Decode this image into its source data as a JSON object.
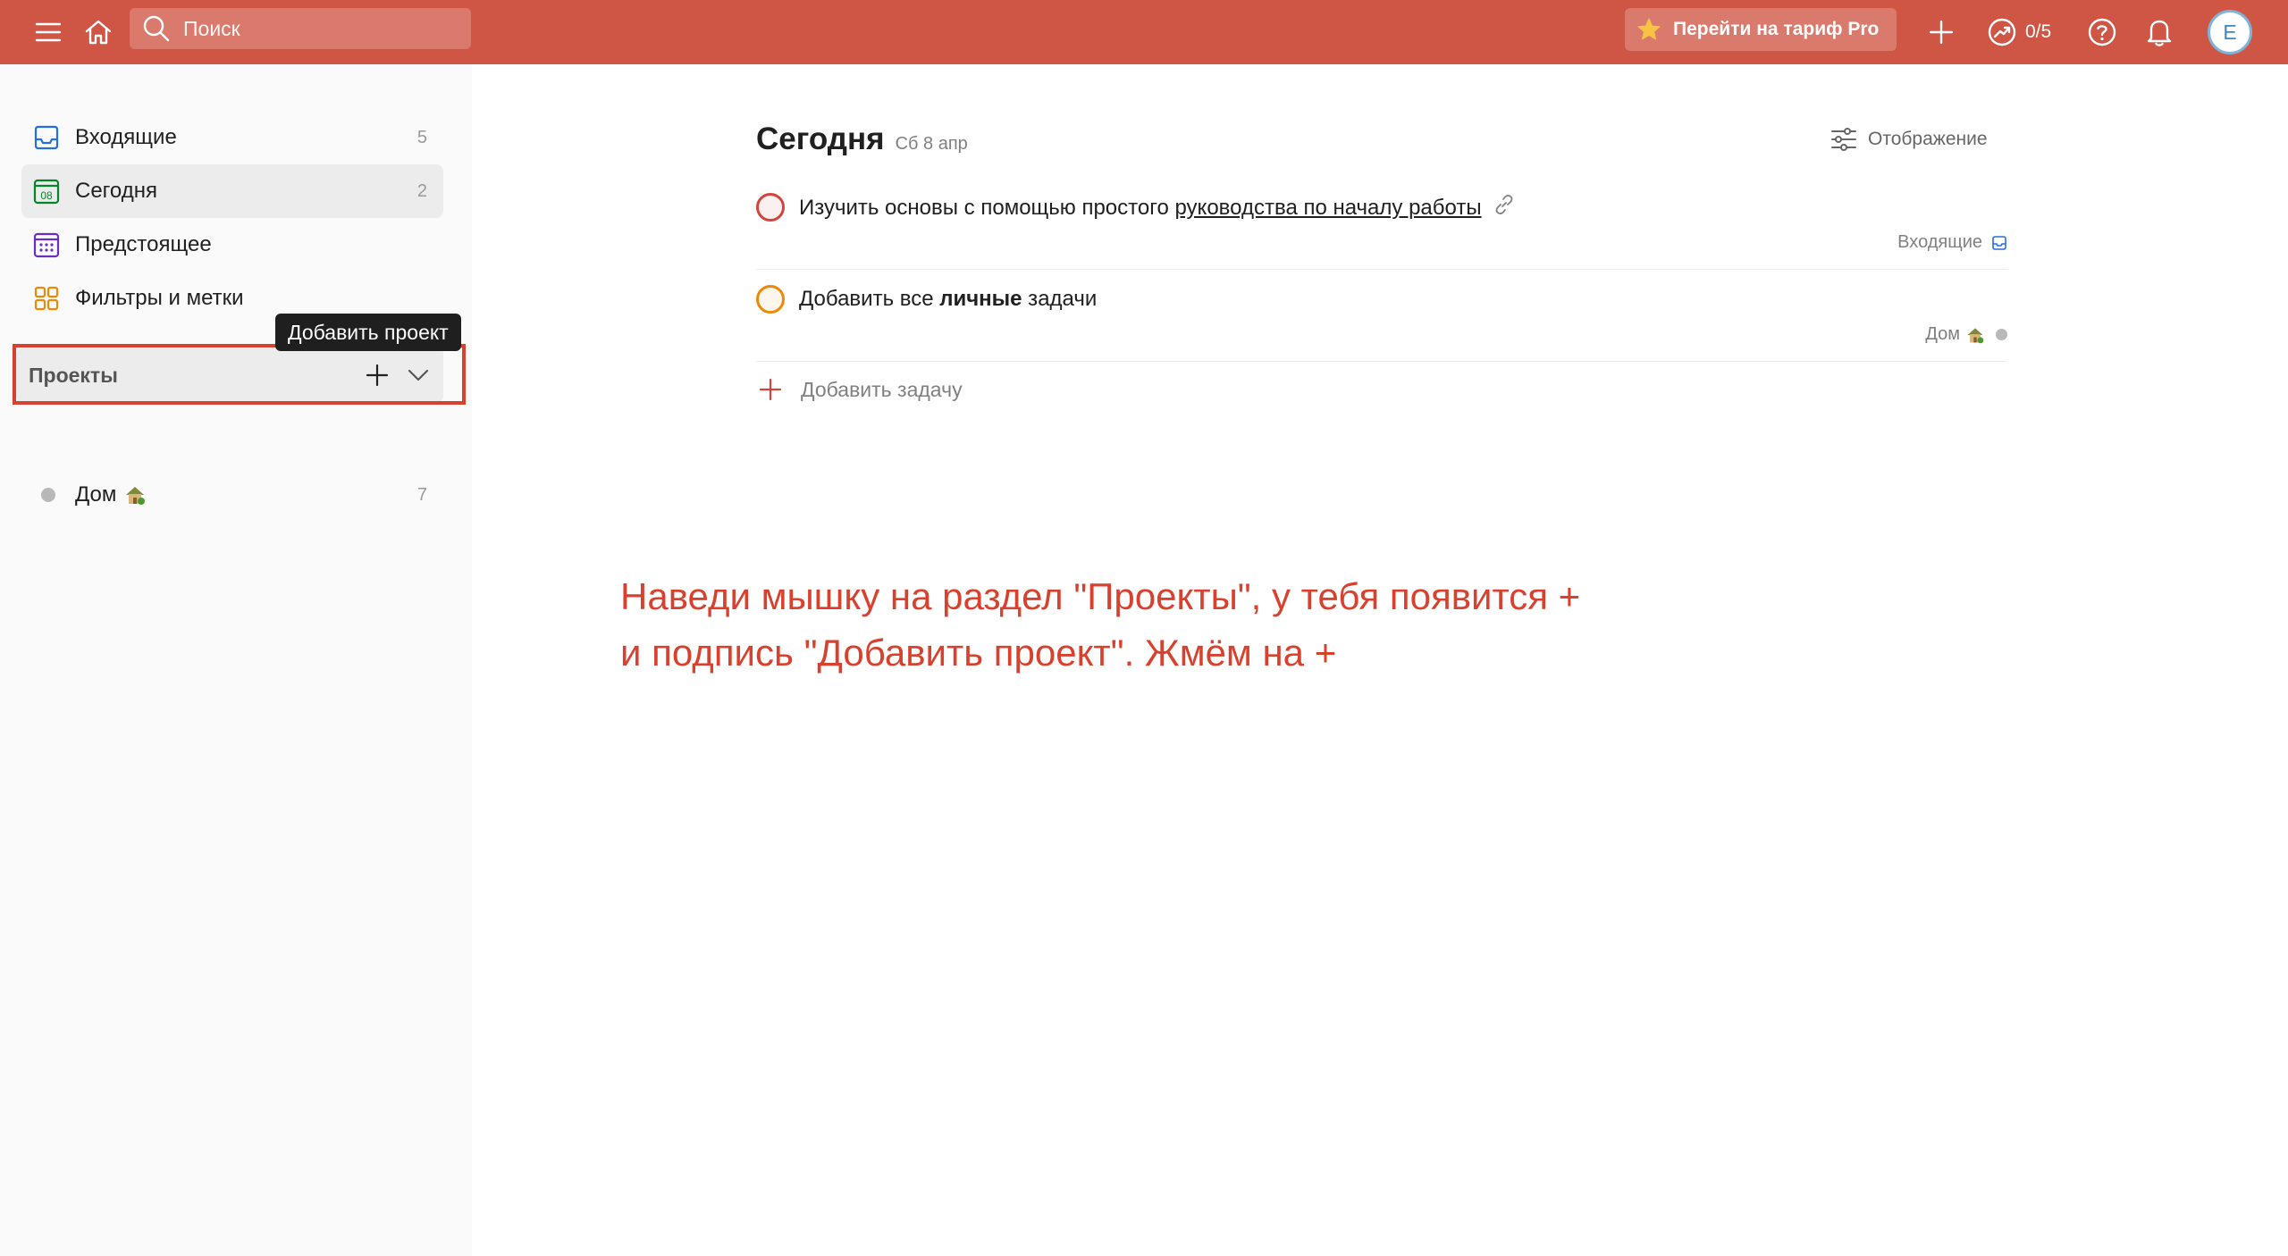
{
  "topbar": {
    "search_placeholder": "Поиск",
    "pro_button_label": "Перейти на тариф Pro",
    "karma_value": "0/5",
    "avatar_letter": "E",
    "brand_color": "#cf5545"
  },
  "sidebar": {
    "items": [
      {
        "label": "Входящие",
        "count": "5",
        "icon": "inbox-icon"
      },
      {
        "label": "Сегодня",
        "count": "2",
        "icon": "calendar-today-icon"
      },
      {
        "label": "Предстоящее",
        "count": "",
        "icon": "calendar-upcoming-icon"
      },
      {
        "label": "Фильтры и метки",
        "count": "",
        "icon": "filters-grid-icon"
      }
    ],
    "projects_label": "Проекты",
    "tooltip": "Добавить проект",
    "projects": [
      {
        "label": "Дом",
        "count": "7",
        "emoji": "house-emoji"
      }
    ]
  },
  "main": {
    "title": "Сегодня",
    "date": "Сб 8 апр",
    "view_label": "Отображение",
    "tasks": [
      {
        "text_before": "Изучить основы с помощью простого ",
        "link_text": "руководства по началу работы",
        "project": "Входящие",
        "circle_color": "#d1453b"
      },
      {
        "text_before": "Добавить все ",
        "bold_text": "личные",
        "text_after": " задачи",
        "project": "Дом",
        "circle_color": "#eb8909"
      }
    ],
    "add_task_label": "Добавить задачу"
  },
  "annotation": {
    "line1": "Наведи мышку на раздел \"Проекты\", у тебя появится +",
    "line2": "и подпись \"Добавить проект\". Жмём на +",
    "color": "#d9412f"
  }
}
